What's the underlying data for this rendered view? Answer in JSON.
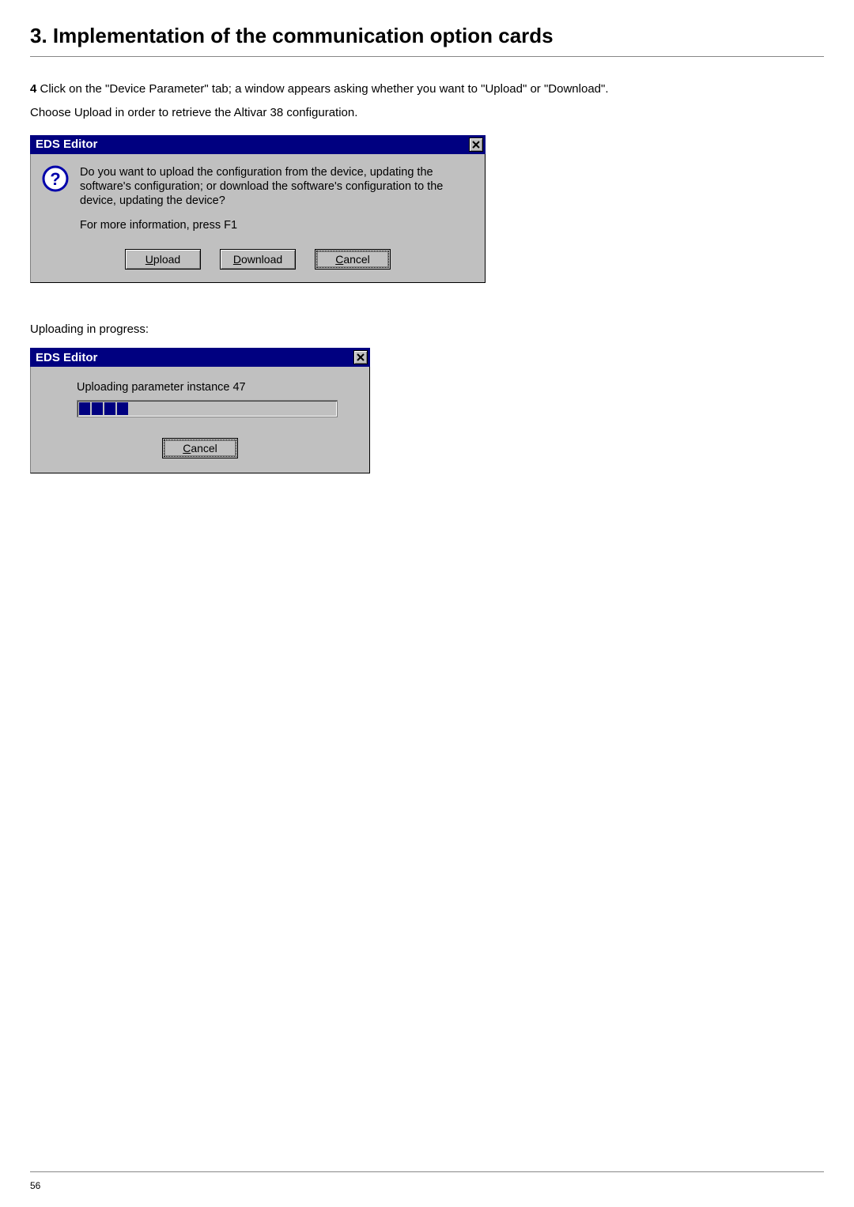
{
  "heading": "3. Implementation of the communication option cards",
  "step_number": "4",
  "step_text": "Click on the \"Device Parameter\" tab; a window appears asking whether you want to \"Upload\" or \"Download\".",
  "choose_text": "Choose Upload in order to retrieve the Altivar 38 configuration.",
  "dialog_confirm": {
    "title": "EDS Editor",
    "message": "Do you want to upload the configuration from the device, updating the software's configuration; or download the software's configuration to the device, updating the device?",
    "hint": "For more information, press F1",
    "btn_upload_pre": "U",
    "btn_upload_rest": "pload",
    "btn_download_pre": "D",
    "btn_download_rest": "ownload",
    "btn_cancel_pre": "C",
    "btn_cancel_rest": "ancel"
  },
  "uploading_label": "Uploading in progress:",
  "dialog_progress": {
    "title": "EDS Editor",
    "status": "Uploading parameter instance 47",
    "btn_cancel_pre": "C",
    "btn_cancel_rest": "ancel"
  },
  "page_number": "56"
}
